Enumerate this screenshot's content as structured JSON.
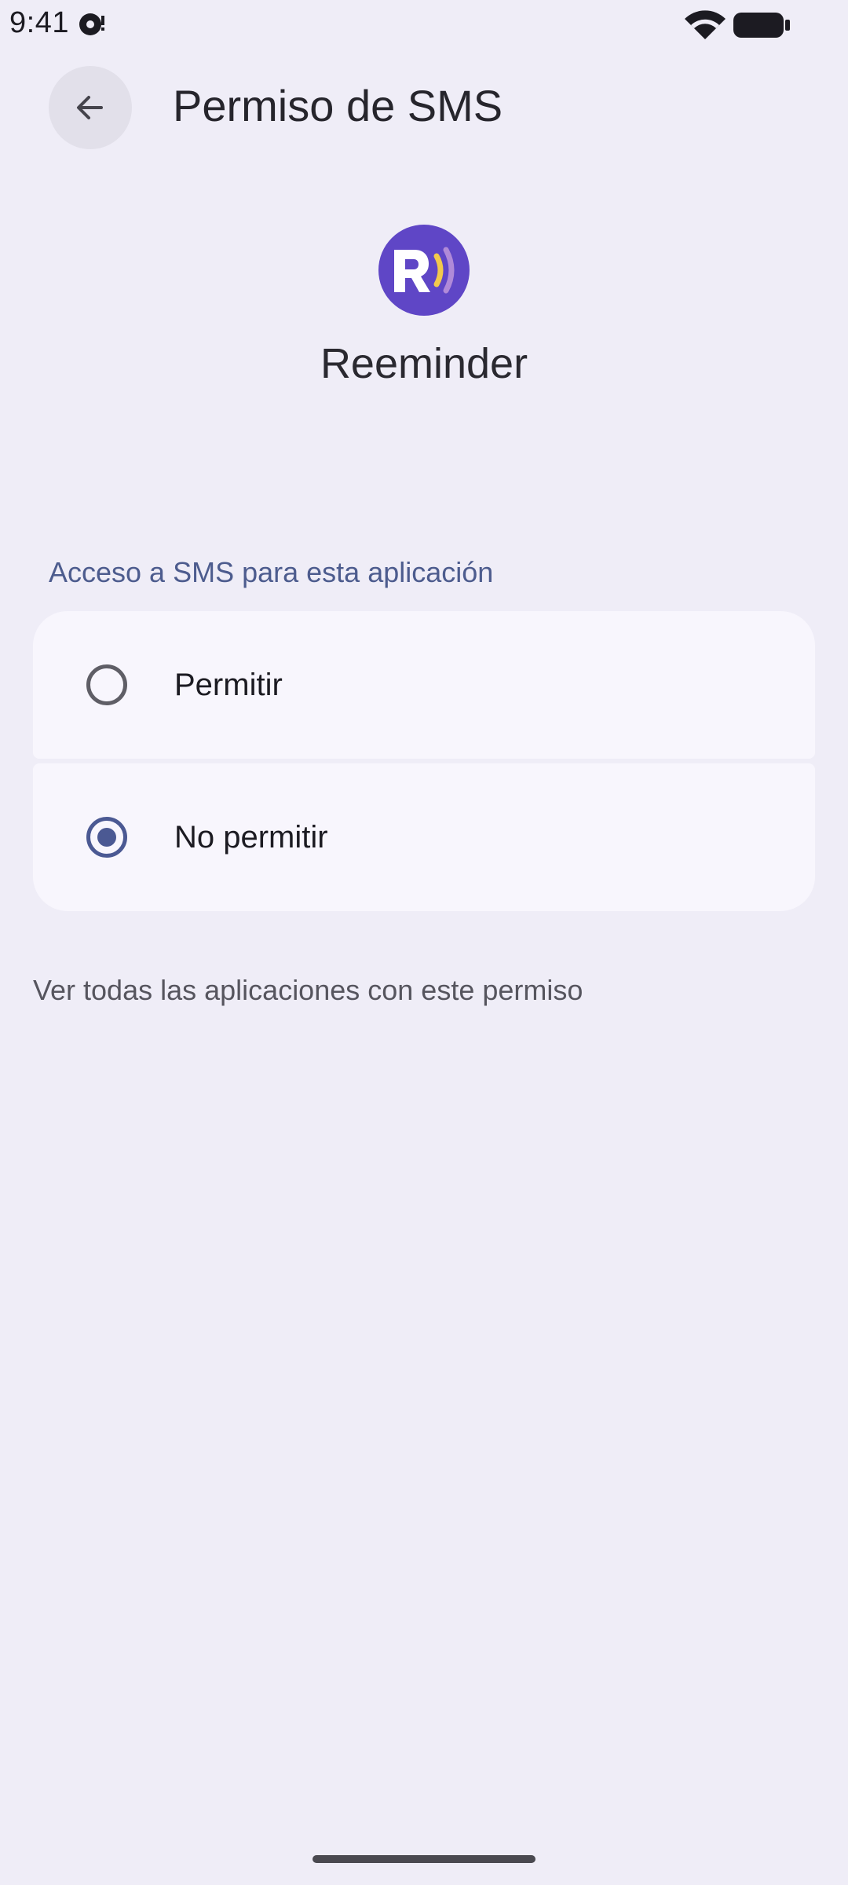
{
  "status_bar": {
    "time": "9:41",
    "icons": [
      "notification-icon",
      "wifi-icon",
      "battery-icon"
    ]
  },
  "header": {
    "back_icon": "arrow-back-icon",
    "title": "Permiso de SMS"
  },
  "app": {
    "name": "Reeminder",
    "icon": "reeminder-app-icon",
    "icon_colors": {
      "background": "#5f46c6",
      "wave_inner": "#f2c94c",
      "wave_outer": "#b08ad8"
    }
  },
  "permission": {
    "section_header": "Acceso a SMS para esta aplicación",
    "options": [
      {
        "label": "Permitir",
        "selected": false
      },
      {
        "label": "No permitir",
        "selected": true
      }
    ]
  },
  "footer_link": "Ver todas las aplicaciones con este permiso",
  "colors": {
    "background": "#efedf7",
    "card": "#f8f6fd",
    "accent": "#4b5993",
    "section_header": "#4d5c8e"
  }
}
